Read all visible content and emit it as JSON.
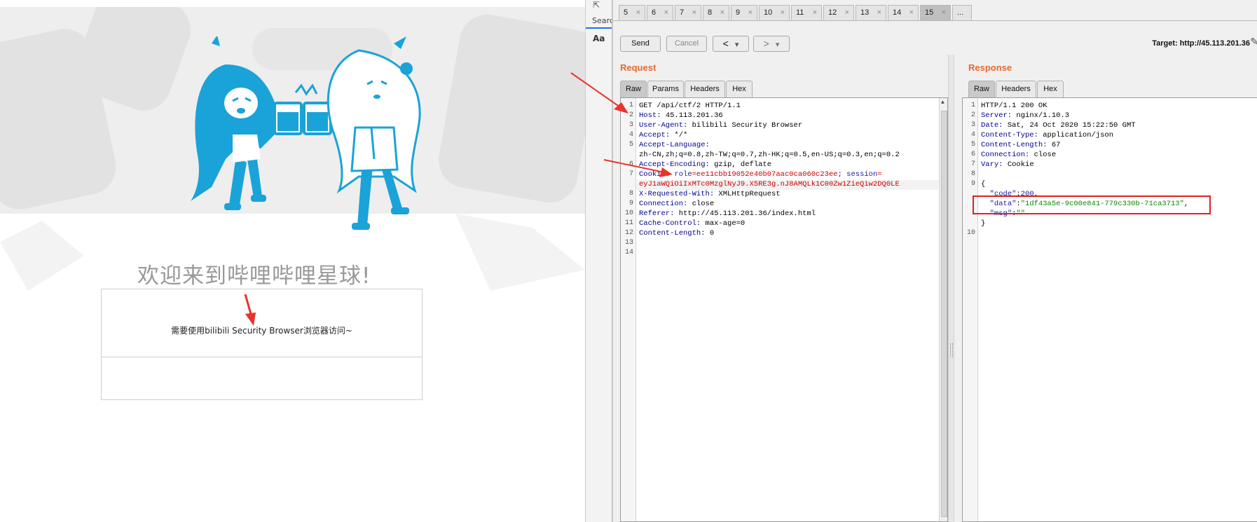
{
  "website": {
    "welcome_title": "欢迎来到哔哩哔哩星球!",
    "notice_text": "需要使用bilibili Security Browser浏览器访问~"
  },
  "devtools": {
    "search_label": "Search",
    "aa_label": "Aa"
  },
  "burp": {
    "tabs": [
      {
        "label": "5",
        "close": "×"
      },
      {
        "label": "6",
        "close": "×"
      },
      {
        "label": "7",
        "close": "×"
      },
      {
        "label": "8",
        "close": "×"
      },
      {
        "label": "9",
        "close": "×"
      },
      {
        "label": "10",
        "close": "×"
      },
      {
        "label": "11",
        "close": "×"
      },
      {
        "label": "12",
        "close": "×"
      },
      {
        "label": "13",
        "close": "×"
      },
      {
        "label": "14",
        "close": "×"
      },
      {
        "label": "15",
        "close": "×",
        "active": true
      },
      {
        "label": "..."
      }
    ],
    "toolbar": {
      "send": "Send",
      "cancel": "Cancel",
      "back": "<",
      "forward": ">",
      "dropdown": "▾",
      "target": "Target: http://45.113.201.36"
    },
    "request": {
      "title": "Request",
      "subtabs": [
        "Raw",
        "Params",
        "Headers",
        "Hex"
      ],
      "line_numbers": [
        "1",
        "2",
        "3",
        "4",
        "5",
        "6",
        "7",
        "",
        "8",
        "9",
        "10",
        "11",
        "12",
        "13",
        "14"
      ],
      "lines": {
        "l1": "GET /api/ctf/2 HTTP/1.1",
        "l2k": "Host:",
        "l2v": " 45.113.201.36",
        "l3k": "User-Agent:",
        "l3v": " bilibili Security Browser",
        "l4k": "Accept:",
        "l4v": " */*",
        "l5k": "Accept-Language:",
        "l5b": "zh-CN,zh;q=0.8,zh-TW;q=0.7,zh-HK;q=0.5,en-US;q=0.3,en;q=0.2",
        "l6k": "Accept-Encoding:",
        "l6v": " gzip, deflate",
        "l7k": "Cookie:",
        "l7a": " role",
        "l7b": "=ee11cbb19052e40b07aac0ca060c23ee",
        "l7c": "; session",
        "l7d": "=",
        "l7e": "eyJ1aWQiOiIxMTc0MzglNyJ9.X5RE3g.nJ8AMQLk1C00Zw1ZieQiw2DQ0LE",
        "l8k": "X-Requested-With:",
        "l8v": " XMLHttpRequest",
        "l9k": "Connection:",
        "l9v": " close",
        "l10k": "Referer:",
        "l10v": " http://45.113.201.36/index.html",
        "l11k": "Cache-Control:",
        "l11v": " max-age=0",
        "l12k": "Content-Length:",
        "l12v": " 0"
      }
    },
    "response": {
      "title": "Response",
      "subtabs": [
        "Raw",
        "Headers",
        "Hex"
      ],
      "line_numbers": [
        "1",
        "2",
        "3",
        "4",
        "5",
        "6",
        "7",
        "8",
        "9",
        "",
        "",
        "",
        "10"
      ],
      "lines": {
        "l1": "HTTP/1.1 200 OK",
        "l2k": "Server:",
        "l2v": " nginx/1.10.3",
        "l3k": "Date:",
        "l3v": " Sat, 24 Oct 2020 15:22:50 GMT",
        "l4k": "Content-Type:",
        "l4v": " application/json",
        "l5k": "Content-Length:",
        "l5v": " 67",
        "l6k": "Connection:",
        "l6v": " close",
        "l7k": "Vary:",
        "l7v": " Cookie",
        "l9": "{",
        "code_key": "\"code\"",
        "code_val": "200",
        "data_key": "\"data\"",
        "data_val": "\"1df43a5e-9c00e841-779c330b-71ca3713\"",
        "msg_key": "\"msg\"",
        "msg_val": "\"\"",
        "close": "}"
      }
    }
  }
}
